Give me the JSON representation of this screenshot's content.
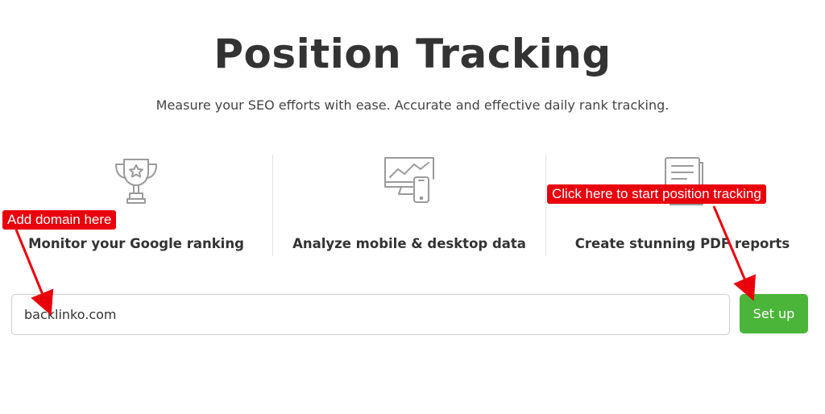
{
  "header": {
    "title": "Position Tracking",
    "subtitle": "Measure your SEO efforts with ease. Accurate and effective daily rank tracking."
  },
  "features": [
    {
      "icon": "trophy-icon",
      "label": "Monitor your Google ranking"
    },
    {
      "icon": "monitor-phone-chart-icon",
      "label": "Analyze mobile & desktop data"
    },
    {
      "icon": "document-report-icon",
      "label": "Create stunning PDF reports"
    }
  ],
  "form": {
    "domain_value": "backlinko.com",
    "setup_label": "Set up"
  },
  "annotations": {
    "add_domain": "Add domain here",
    "start_tracking": "Click here to start position tracking"
  },
  "colors": {
    "accent_green": "#4bb53a",
    "annotation_red": "#e8000b",
    "text": "#333333",
    "icon_gray": "#9a9a9a"
  }
}
